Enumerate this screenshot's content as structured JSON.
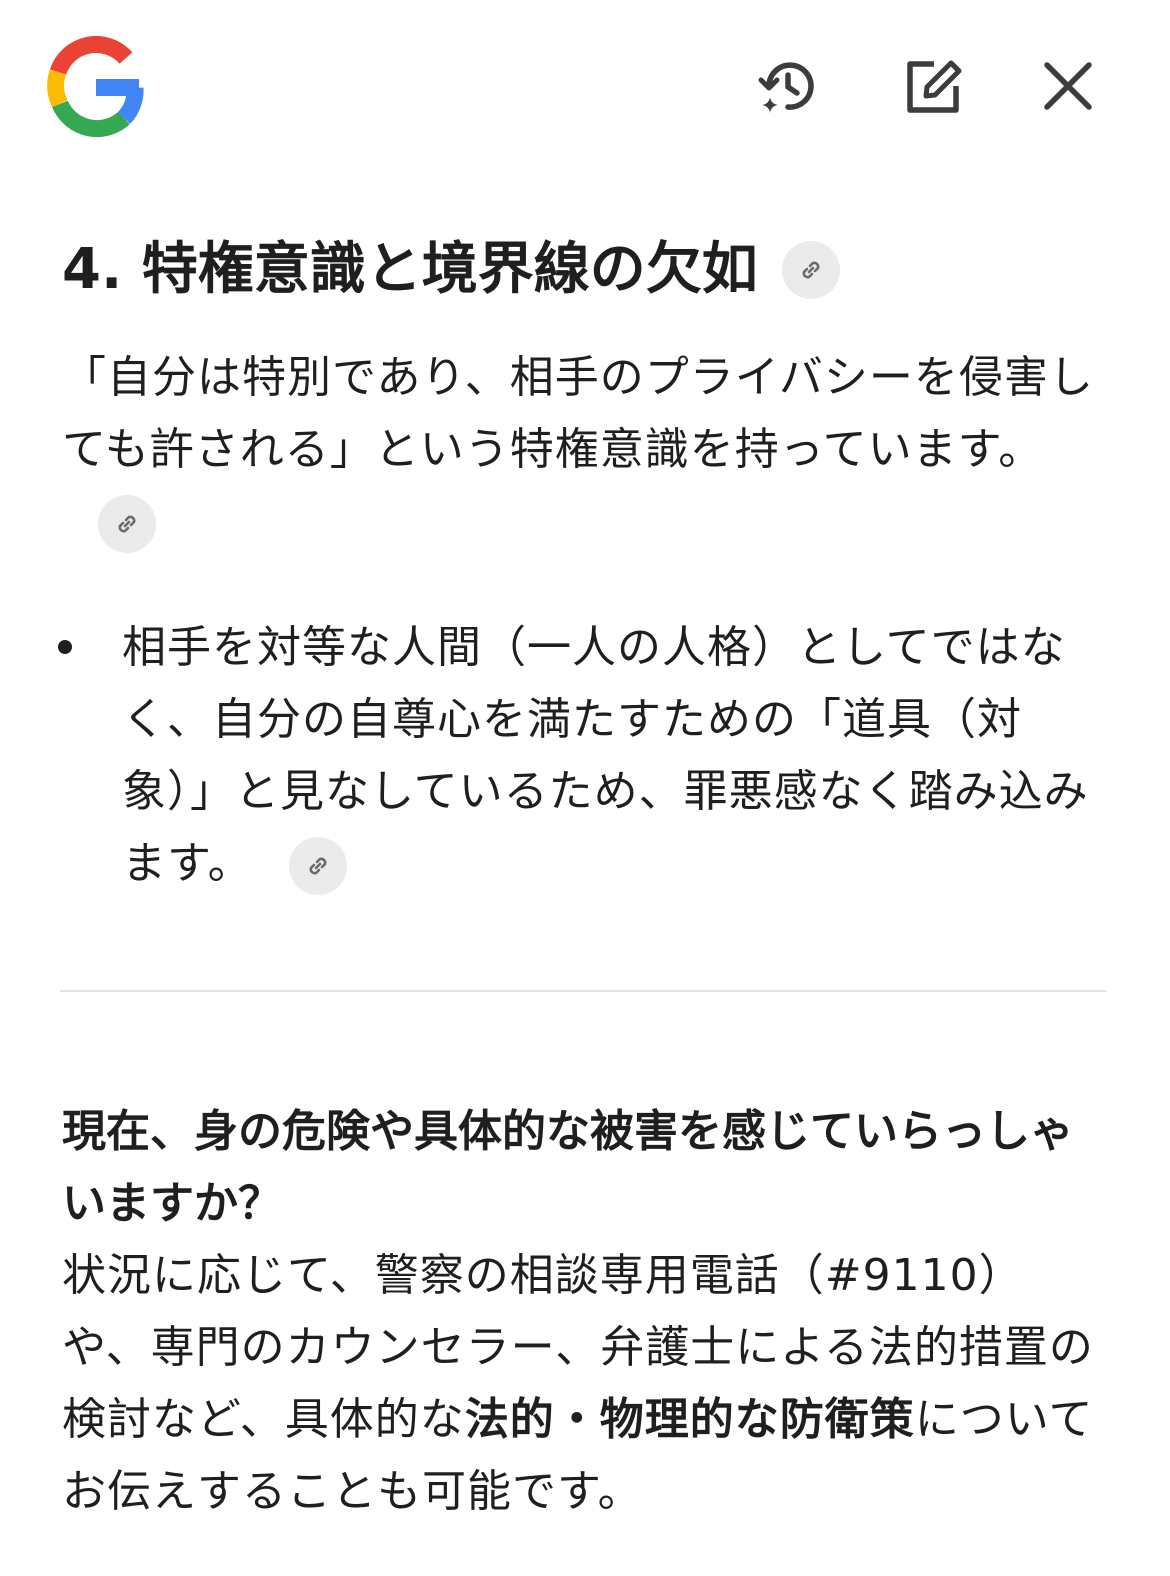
{
  "header": {
    "logo_icon": "google-g-icon",
    "actions": [
      {
        "icon": "history-sparkle-icon"
      },
      {
        "icon": "edit-icon"
      },
      {
        "icon": "close-icon"
      }
    ]
  },
  "section": {
    "heading": "4. 特権意識と境界線の欠如",
    "paragraph": "「自分は特別であり、相手のプライバシーを侵害しても許される」という特権意識を持っています。",
    "bullets": [
      "相手を対等な人間（一人の人格）としてではなく、自分の自尊心を満たすための「道具（対象）」と見なしているため、罪悪感なく踏み込みます。"
    ]
  },
  "followup": {
    "question": "現在、身の危険や具体的な被害を感じていらっしゃいますか？",
    "answer_before": "状況に応じて、警察の相談専用電話（#9110）や、専門のカウンセラー、弁護士による法的措置の検討など、具体的な",
    "answer_bold": "法的・物理的な防衛策",
    "answer_after": "についてお伝えすることも可能です。"
  },
  "colors": {
    "text": "#1f1f1f",
    "chip_bg": "#ebebeb",
    "divider": "#e2e2e2",
    "google_red": "#ea4335",
    "google_yellow": "#fbbc05",
    "google_green": "#34a853",
    "google_blue": "#4285f4"
  }
}
